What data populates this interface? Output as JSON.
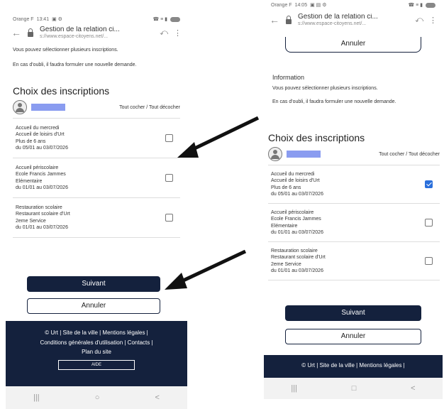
{
  "left": {
    "status": {
      "carrier": "Orange F",
      "time": "13:41",
      "icons": "▣ ⚙",
      "right_icons": "☎ ≡ ▮"
    },
    "browser": {
      "title": "Gestion de la relation ci...",
      "url": "s://www.espace-citoyens.net/..."
    },
    "intro": [
      "Vous pouvez sélectionner plusieurs inscriptions.",
      "En cas d'oubli, il faudra formuler une nouvelle demande."
    ],
    "section_title": "Choix des inscriptions",
    "tout_cocher": "Tout cocher / Tout décocher",
    "items": [
      {
        "lines": [
          "Accueil du mercredi",
          "Accueil de loisirs d'Urt",
          "Plus de 6 ans",
          "du 05/01 au 03/07/2026"
        ],
        "checked": false
      },
      {
        "lines": [
          "Accueil périscolaire",
          "Ecole Francis Jammes",
          "Elémentaire",
          "du 01/01 au 03/07/2026"
        ],
        "checked": false
      },
      {
        "lines": [
          "Restauration scolaire",
          "Restaurant scolaire d'Urt",
          "2eme Service",
          "du 01/01 au 03/07/2026"
        ],
        "checked": false
      }
    ],
    "next_label": "Suivant",
    "cancel_label": "Annuler",
    "footer_lines": [
      "© Urt | Site de la ville | Mentions légales |",
      "Conditions générales d'utilisation | Contacts |",
      "Plan du site"
    ],
    "aide_label": "AIDE",
    "nav": [
      "|||",
      "○",
      "<"
    ]
  },
  "right": {
    "status": {
      "carrier": "Orange F",
      "time": "14:05",
      "icons": "▣ ▤ ⚙",
      "right_icons": "☎ ≡ ▮"
    },
    "browser": {
      "title": "Gestion de la relation ci...",
      "url": "s://www.espace-citoyens.net/..."
    },
    "top_cancel_label": "Annuler",
    "info_title": "Information",
    "intro": [
      "Vous pouvez sélectionner plusieurs inscriptions.",
      "En cas d'oubli, il faudra formuler une nouvelle demande."
    ],
    "section_title": "Choix des inscriptions",
    "tout_cocher": "Tout cocher / Tout décocher",
    "items": [
      {
        "lines": [
          "Accueil du mercredi",
          "Accueil de loisirs d'Urt",
          "Plus de 6 ans",
          "du 05/01 au 03/07/2026"
        ],
        "checked": true
      },
      {
        "lines": [
          "Accueil périscolaire",
          "Ecole Francis Jammes",
          "Elémentaire",
          "du 01/01 au 03/07/2026"
        ],
        "checked": false
      },
      {
        "lines": [
          "Restauration scolaire",
          "Restaurant scolaire d'Urt",
          "2eme Service",
          "du 01/01 au 03/07/2026"
        ],
        "checked": false
      }
    ],
    "next_label": "Suivant",
    "cancel_label": "Annuler",
    "footer_lines": [
      "© Urt | Site de la ville | Mentions légales |"
    ],
    "nav": [
      "|||",
      "□",
      "<"
    ]
  },
  "colors": {
    "primary": "#14213d",
    "checkbox_checked": "#2a6fdb",
    "name_redaction": "#8a9cf0"
  }
}
